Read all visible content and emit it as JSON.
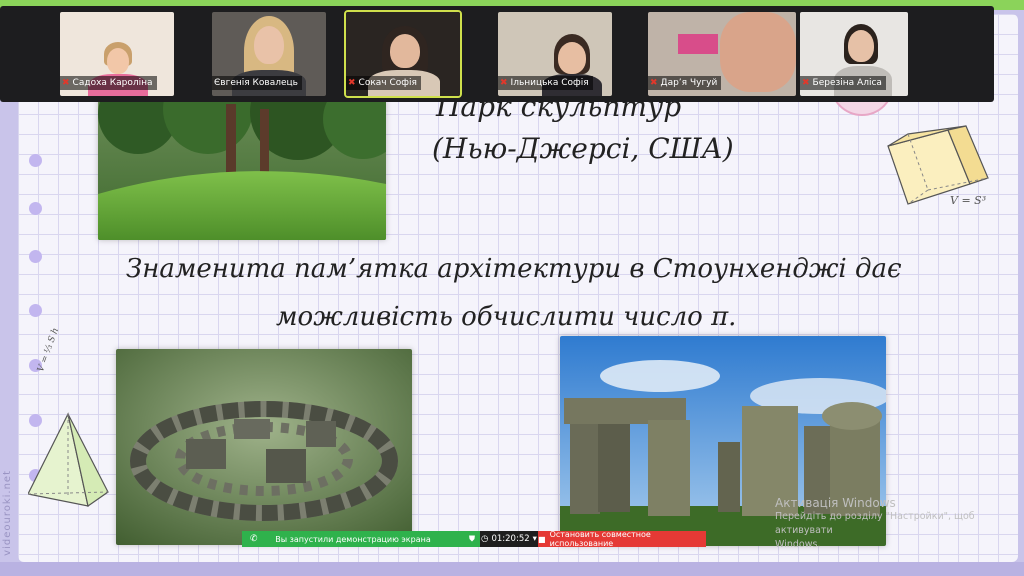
{
  "participants": [
    {
      "name": "Садоха Кароліна",
      "muted": true
    },
    {
      "name": "Євгенія Ковалець",
      "muted": false
    },
    {
      "name": "Сокач Софія",
      "muted": true,
      "active": true
    },
    {
      "name": "Ільницька Софія",
      "muted": true
    },
    {
      "name": "Дар’я Чугуй",
      "muted": true
    },
    {
      "name": "Березіна Аліса",
      "muted": true
    }
  ],
  "slide": {
    "title_line1": "Парк скульптур",
    "title_line2": "(Нью-Джерсі, США)",
    "statement_line1": "Знаменита пам’ятка архітектури в Стоунхенджі дає",
    "statement_line2": "можливість обчислити число π.",
    "cube_formula": "V = S³",
    "pyramid_formula": "V = ⅓ S h",
    "side_watermark": "videouroki.net"
  },
  "windows_activation": {
    "title": "Активація Windows",
    "line1": "Перейдіть до розділу \"Настройки\", щоб активувати",
    "line2": "Windows."
  },
  "sharebar": {
    "status": "Вы запустили демонстрацию экрана",
    "timer": "01:20:52",
    "stop": "Остановить совместное использование"
  },
  "colors": {
    "accent_green": "#2fb24c",
    "stop_red": "#e53935",
    "active_tile": "#cfe04c",
    "grid_line": "#d9d6ef"
  }
}
